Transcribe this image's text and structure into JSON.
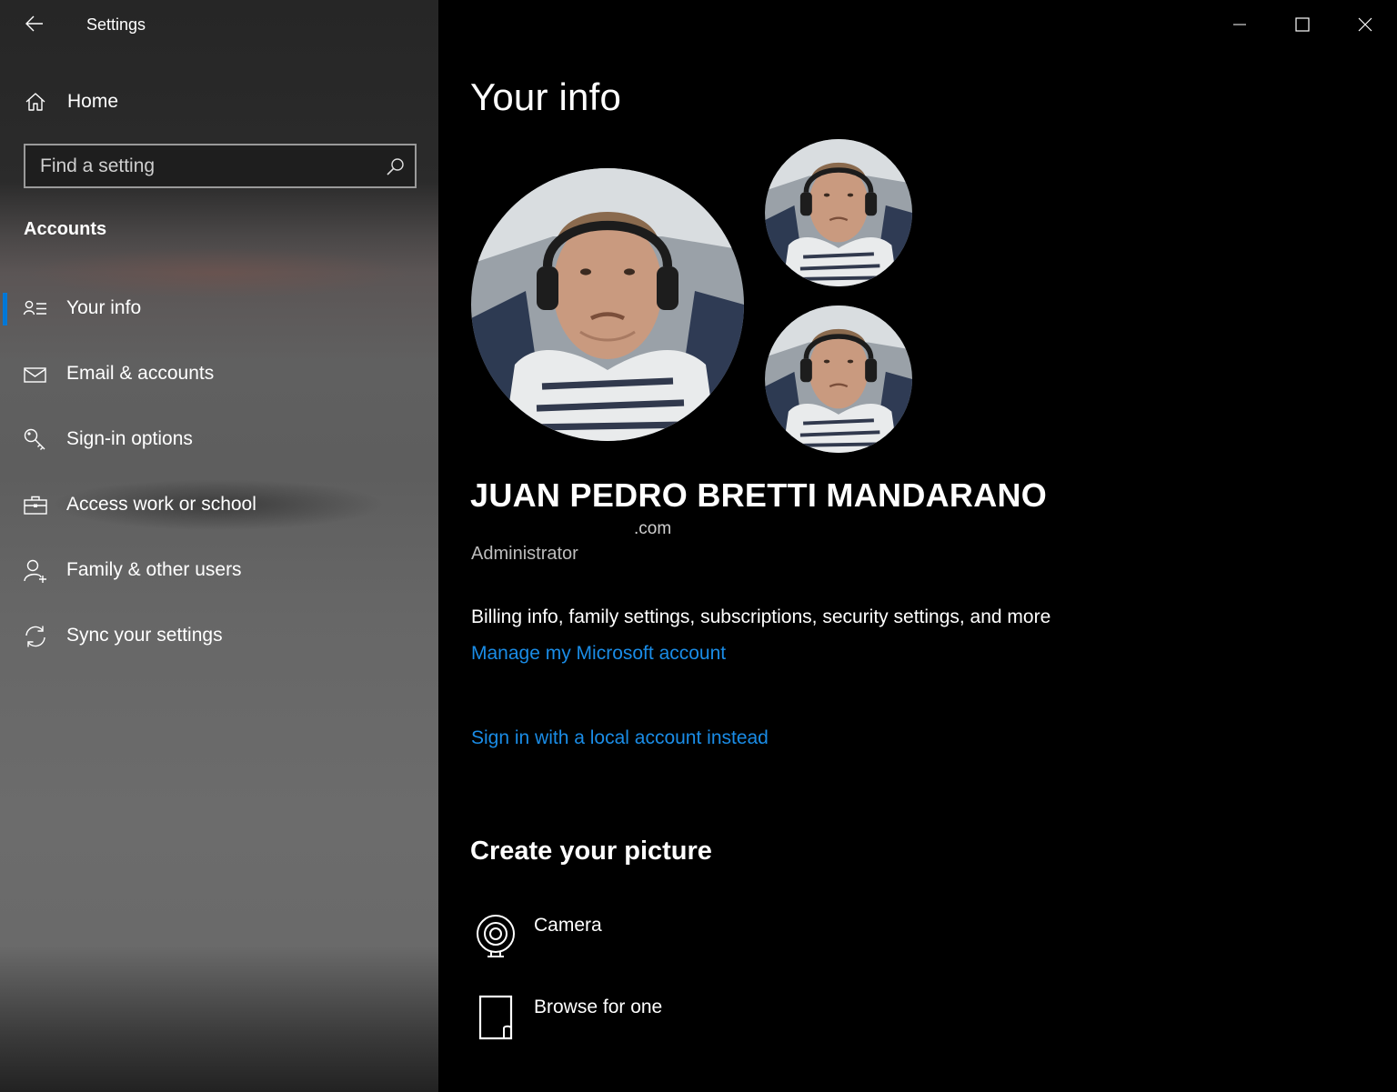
{
  "window": {
    "title": "Settings"
  },
  "sidebar": {
    "home_label": "Home",
    "search_placeholder": "Find a setting",
    "section_heading": "Accounts",
    "items": [
      {
        "label": "Your info",
        "icon": "person-list-icon",
        "selected": true
      },
      {
        "label": "Email & accounts",
        "icon": "envelope-icon",
        "selected": false
      },
      {
        "label": "Sign-in options",
        "icon": "key-icon",
        "selected": false
      },
      {
        "label": "Access work or school",
        "icon": "briefcase-icon",
        "selected": false
      },
      {
        "label": "Family & other users",
        "icon": "add-person-icon",
        "selected": false
      },
      {
        "label": "Sync your settings",
        "icon": "sync-icon",
        "selected": false
      }
    ]
  },
  "main": {
    "title": "Your info",
    "user": {
      "name": "JUAN PEDRO BRETTI MANDARANO",
      "email_suffix": ".com",
      "role": "Administrator"
    },
    "billing_text": "Billing info, family settings, subscriptions, security settings, and more",
    "manage_link": "Manage my Microsoft account",
    "local_account_link": "Sign in with a local account instead",
    "create_picture": {
      "heading": "Create your picture",
      "options": [
        {
          "label": "Camera",
          "icon": "webcam-icon"
        },
        {
          "label": "Browse for one",
          "icon": "file-icon"
        }
      ]
    }
  },
  "colors": {
    "accent": "#0078d7",
    "link": "#1a8ce6",
    "background": "#000000"
  }
}
